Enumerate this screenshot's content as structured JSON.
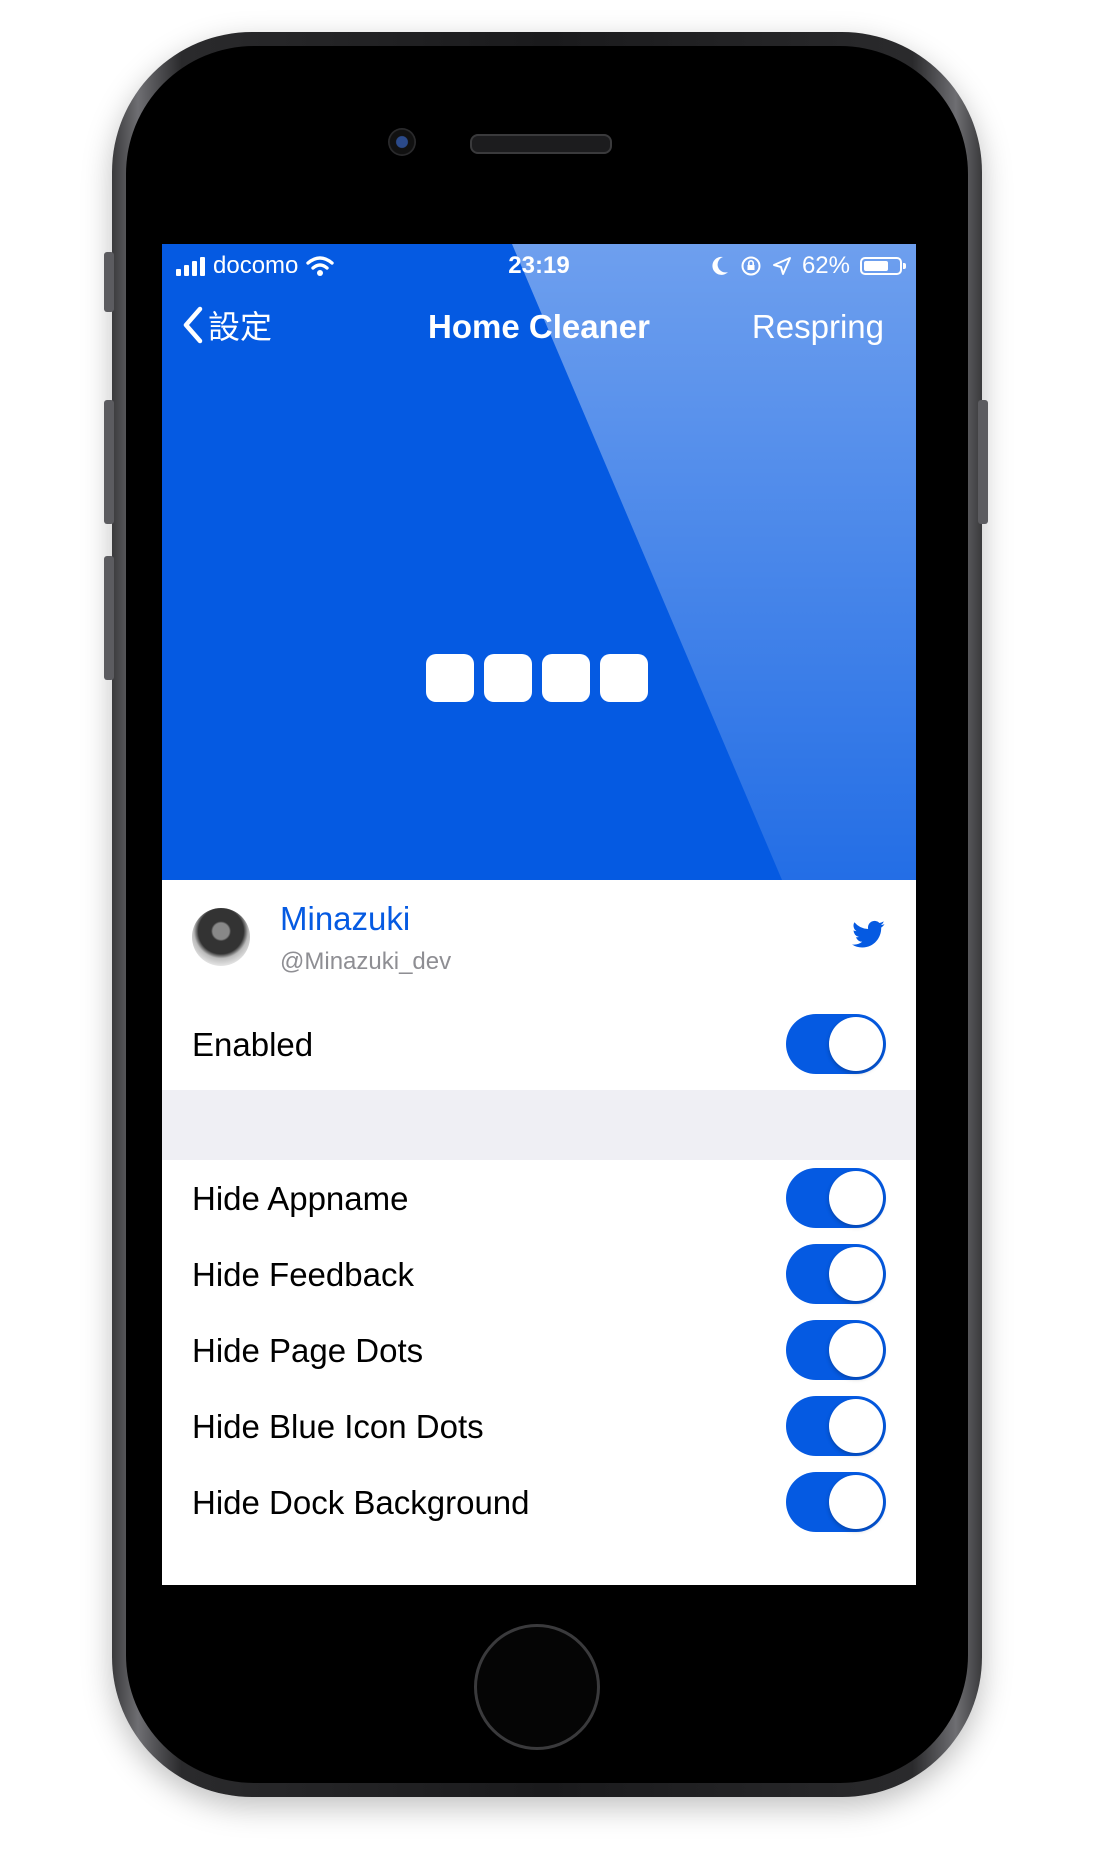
{
  "status_bar": {
    "carrier": "docomo",
    "time": "23:19",
    "battery": "62%",
    "battery_level": 0.62
  },
  "nav": {
    "back_label": "設定",
    "title": "Home Cleaner",
    "right_button": "Respring"
  },
  "author": {
    "name": "Minazuki",
    "handle": "@Minazuki_dev",
    "link_icon": "twitter-icon"
  },
  "settings": {
    "enabled": {
      "label": "Enabled",
      "on": true
    },
    "items": [
      {
        "label": "Hide Appname",
        "on": true
      },
      {
        "label": "Hide Feedback",
        "on": true
      },
      {
        "label": "Hide Page Dots",
        "on": true
      },
      {
        "label": "Hide Blue Icon Dots",
        "on": true
      },
      {
        "label": "Hide Dock Background",
        "on": true
      }
    ]
  },
  "colors": {
    "accent": "#055ae2",
    "section_background": "#efeff4",
    "secondary_text": "#8e8e93"
  }
}
